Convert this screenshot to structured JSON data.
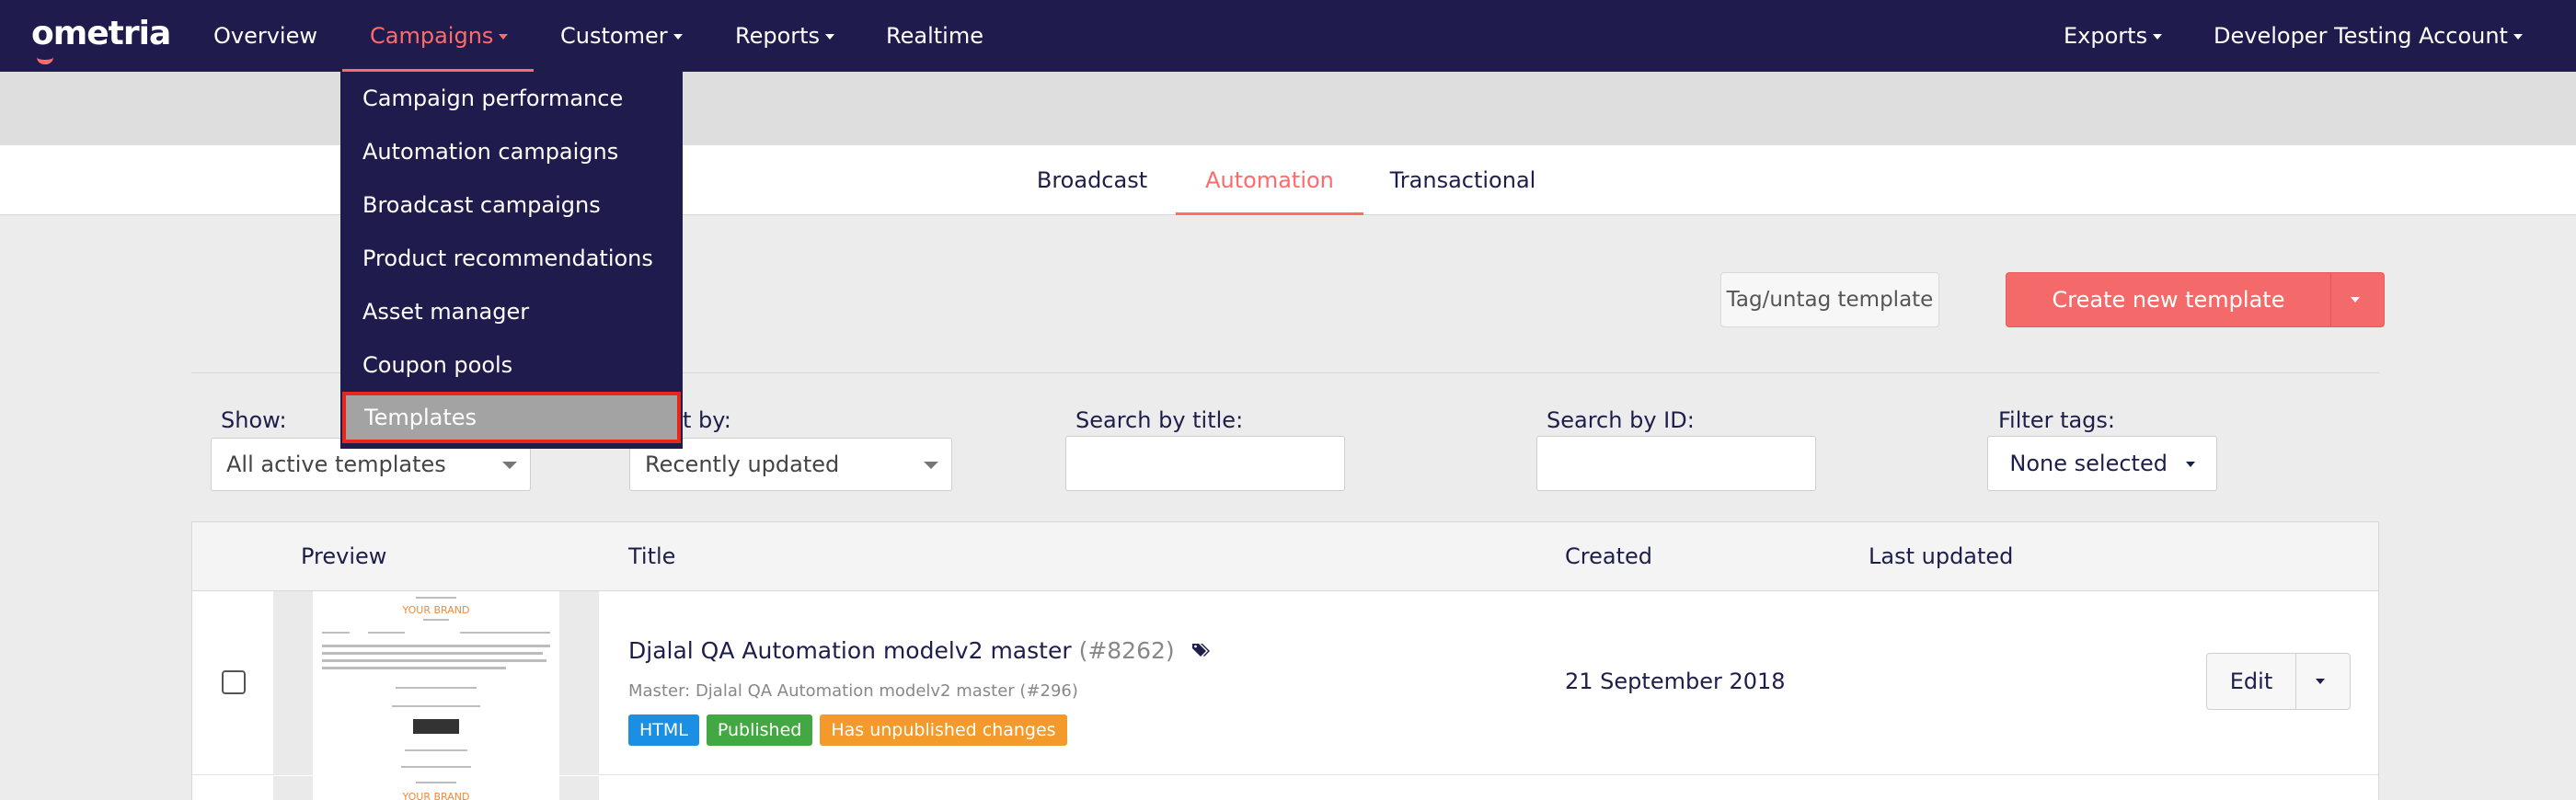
{
  "nav": {
    "logo": "ometria",
    "items": [
      {
        "label": "Overview",
        "caret": false
      },
      {
        "label": "Campaigns",
        "caret": true,
        "active": true
      },
      {
        "label": "Customer",
        "caret": true
      },
      {
        "label": "Reports",
        "caret": true
      },
      {
        "label": "Realtime",
        "caret": false
      }
    ],
    "right_items": [
      {
        "label": "Exports",
        "caret": true
      },
      {
        "label": "Developer Testing Account",
        "caret": true
      }
    ]
  },
  "campaigns_menu": {
    "items": [
      "Campaign performance",
      "Automation campaigns",
      "Broadcast campaigns",
      "Product recommendations",
      "Asset manager",
      "Coupon pools",
      "Templates"
    ],
    "highlighted": "Templates"
  },
  "subtabs": {
    "broadcast": "Broadcast",
    "automation": "Automation",
    "transactional": "Transactional",
    "active": "Automation"
  },
  "actions": {
    "tag_untag": "Tag/untag template",
    "create_new": "Create new template"
  },
  "filters": {
    "show_label": "Show:",
    "show_value": "All active templates",
    "sort_label": "t by:",
    "sort_value": "Recently updated",
    "search_title_label": "Search by title:",
    "search_title_value": "",
    "search_id_label": "Search by ID:",
    "search_id_value": "",
    "filter_tags_label": "Filter tags:",
    "filter_tags_value": "None selected"
  },
  "table": {
    "headers": {
      "preview": "Preview",
      "title": "Title",
      "created": "Created",
      "last_updated": "Last updated"
    },
    "rows": [
      {
        "title": "Djalal QA Automation modelv2 master",
        "id": "(#8262)",
        "master": "Master: Djalal QA Automation modelv2 master (#296)",
        "badges": [
          {
            "label": "HTML",
            "color": "#1a8fe3"
          },
          {
            "label": "Published",
            "color": "#43a843"
          },
          {
            "label": "Has unpublished changes",
            "color": "#f39a2b"
          }
        ],
        "created": "21 September 2018",
        "last_updated": "",
        "edit_label": "Edit"
      }
    ]
  },
  "preview_thumb": {
    "brand": "YOUR BRAND"
  },
  "colors": {
    "nav_bg": "#1f1c4d",
    "accent": "#ff6b6b",
    "create_button": "#f46a6a",
    "highlight_border": "#e8261a"
  }
}
